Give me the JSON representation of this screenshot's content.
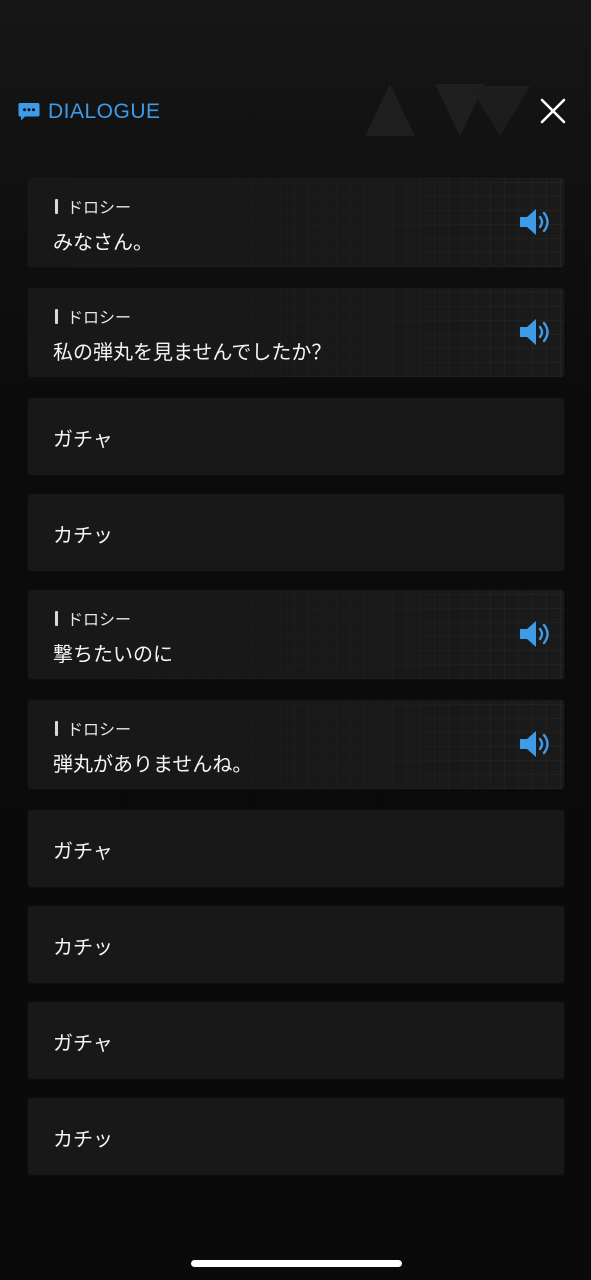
{
  "header": {
    "title": "DIALOGUE",
    "accent": "#3d9be8"
  },
  "dialogue": [
    {
      "kind": "speech",
      "speaker": "ドロシー",
      "text": "みなさん。"
    },
    {
      "kind": "speech",
      "speaker": "ドロシー",
      "text": "私の弾丸を見ませんでしたか？"
    },
    {
      "kind": "sfx",
      "text": "ガチャ"
    },
    {
      "kind": "sfx",
      "text": "カチッ"
    },
    {
      "kind": "speech",
      "speaker": "ドロシー",
      "text": "撃ちたいのに"
    },
    {
      "kind": "speech",
      "speaker": "ドロシー",
      "text": "弾丸がありませんね。"
    },
    {
      "kind": "sfx",
      "text": "ガチャ"
    },
    {
      "kind": "sfx",
      "text": "カチッ"
    },
    {
      "kind": "sfx",
      "text": "ガチャ"
    },
    {
      "kind": "sfx",
      "text": "カチッ"
    }
  ],
  "icons": {
    "header": "chat-bubble-icon",
    "close": "close-icon",
    "voice": "speaker-volume-icon"
  }
}
